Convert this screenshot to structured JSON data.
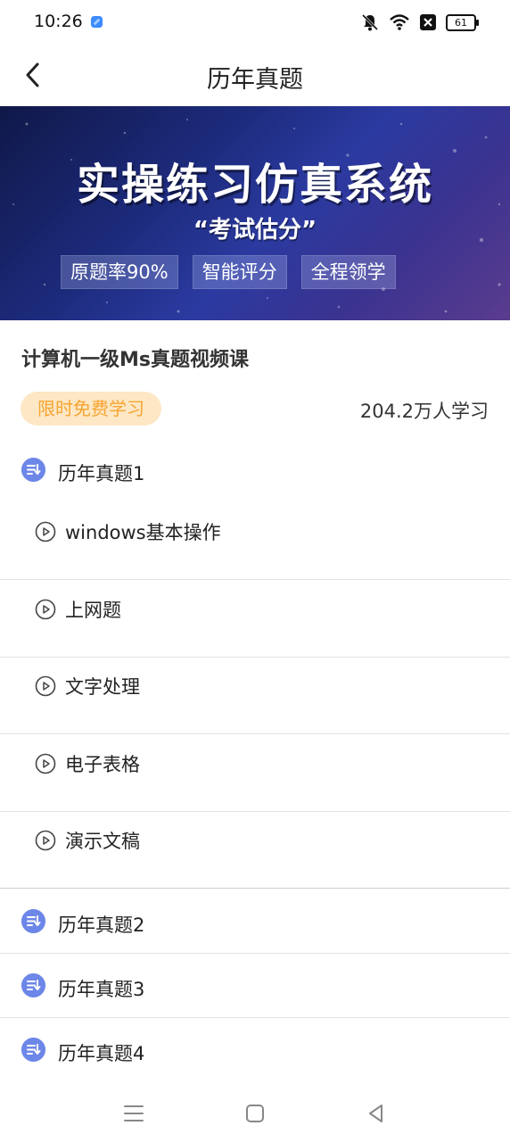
{
  "status_bar": {
    "time": "10:26",
    "battery": "61",
    "icons": [
      "app-notification-icon",
      "mute-bell-icon",
      "wifi-icon",
      "sim-x-icon",
      "battery-icon"
    ]
  },
  "nav": {
    "title": "历年真题",
    "back_icon": "chevron-left-icon"
  },
  "banner": {
    "title": "实操练习仿真系统",
    "subtitle": "“考试估分”",
    "tags": [
      "原题率90%",
      "智能评分",
      "全程领学"
    ]
  },
  "course": {
    "title": "计算机一级Ms真题视频课",
    "free_badge": "限时免费学习",
    "learners": "204.2万人学习"
  },
  "chapters": [
    {
      "label": "历年真题1",
      "expanded": true,
      "lessons": [
        "windows基本操作",
        "上网题",
        "文字处理",
        "电子表格",
        "演示文稿"
      ]
    },
    {
      "label": "历年真题2",
      "expanded": false
    },
    {
      "label": "历年真题3",
      "expanded": false
    },
    {
      "label": "历年真题4",
      "expanded": false
    }
  ],
  "colors": {
    "accent_blue": "#6d87e8",
    "badge_bg": "#fde7c5",
    "badge_text": "#f6a531"
  }
}
